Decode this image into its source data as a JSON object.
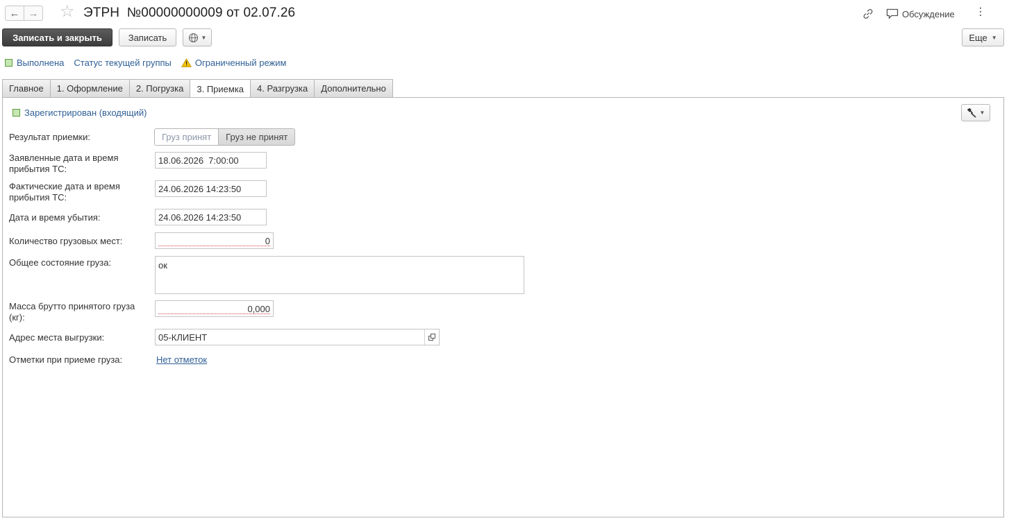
{
  "header": {
    "title": "ЭТРН  №00000000009 от 02.07.26",
    "discuss_label": "Обсуждение"
  },
  "toolbar": {
    "save_close_label": "Записать и закрыть",
    "save_label": "Записать",
    "more_label": "Еще"
  },
  "status": {
    "completed_label": "Выполнена",
    "group_status_label": "Статус текущей группы",
    "limited_mode_label": "Ограниченный режим"
  },
  "tabs": [
    {
      "label": "Главное"
    },
    {
      "label": "1. Оформление"
    },
    {
      "label": "2. Погрузка"
    },
    {
      "label": "3. Приемка"
    },
    {
      "label": "4. Разгрузка"
    },
    {
      "label": "Дополнительно"
    }
  ],
  "form": {
    "registered_label": "Зарегистрирован (входящий)",
    "result_label": "Результат приемки:",
    "result_accepted": "Груз принят",
    "result_not_accepted": "Груз не принят",
    "declared_arrival_label": "Заявленные дата и время прибытия ТС:",
    "declared_arrival_value": "18.06.2026  7:00:00",
    "actual_arrival_label": "Фактические дата и время прибытия ТС:",
    "actual_arrival_value": "24.06.2026 14:23:50",
    "departure_label": "Дата и время убытия:",
    "departure_value": "24.06.2026 14:23:50",
    "cargo_places_label": "Количество грузовых мест:",
    "cargo_places_value": "0",
    "condition_label": "Общее состояние груза:",
    "condition_value": "ок",
    "gross_mass_label": "Масса брутто принятого груза (кг):",
    "gross_mass_value": "0,000",
    "unload_address_label": "Адрес места выгрузки:",
    "unload_address_value": "05-КЛИЕНТ",
    "marks_label": "Отметки при приеме груза:",
    "marks_value": "Нет отметок"
  },
  "colors": {
    "link": "#2f5f96",
    "status_green": "#c6e6b3",
    "warning_yellow": "#f5c400",
    "primary_button": "#444444"
  }
}
